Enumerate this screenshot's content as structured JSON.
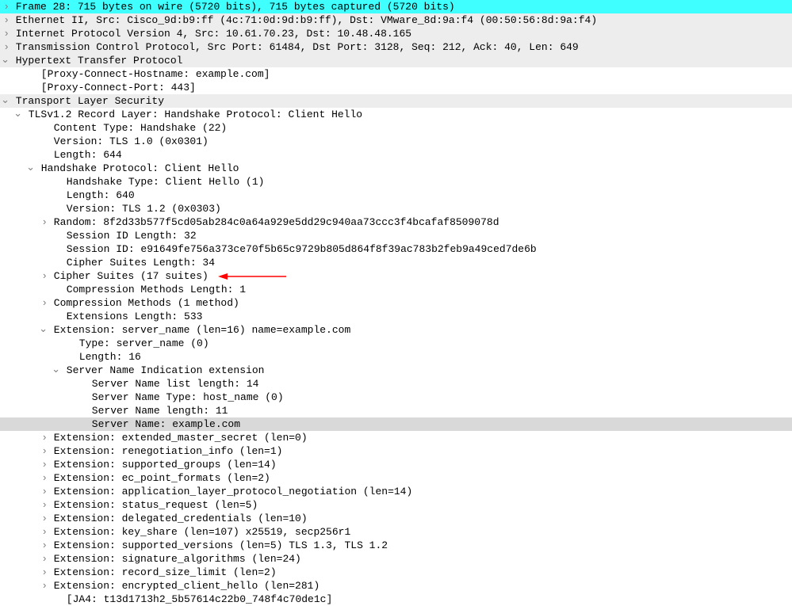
{
  "lines": [
    {
      "indent": 0,
      "g": "arrow",
      "hl": "cyan",
      "k": "l0",
      "t": "Frame 28: 715 bytes on wire (5720 bits), 715 bytes captured (5720 bits)"
    },
    {
      "indent": 0,
      "g": "arrow",
      "hl": "grey",
      "k": "l1",
      "t": "Ethernet II, Src: Cisco_9d:b9:ff (4c:71:0d:9d:b9:ff), Dst: VMware_8d:9a:f4 (00:50:56:8d:9a:f4)"
    },
    {
      "indent": 0,
      "g": "arrow",
      "hl": "grey",
      "k": "l2",
      "t": "Internet Protocol Version 4, Src: 10.61.70.23, Dst: 10.48.48.165"
    },
    {
      "indent": 0,
      "g": "arrow",
      "hl": "grey",
      "k": "l3",
      "t": "Transmission Control Protocol, Src Port: 61484, Dst Port: 3128, Seq: 212, Ack: 40, Len: 649"
    },
    {
      "indent": 0,
      "g": "open",
      "hl": "grey",
      "k": "l4",
      "t": "Hypertext Transfer Protocol"
    },
    {
      "indent": 2,
      "g": "",
      "hl": "",
      "k": "l5",
      "t": "[Proxy-Connect-Hostname: example.com]"
    },
    {
      "indent": 2,
      "g": "",
      "hl": "",
      "k": "l6",
      "t": "[Proxy-Connect-Port: 443]"
    },
    {
      "indent": 0,
      "g": "open",
      "hl": "grey",
      "k": "l7",
      "t": "Transport Layer Security"
    },
    {
      "indent": 1,
      "g": "open",
      "hl": "",
      "k": "l8",
      "t": "TLSv1.2 Record Layer: Handshake Protocol: Client Hello"
    },
    {
      "indent": 3,
      "g": "",
      "hl": "",
      "k": "l9",
      "t": "Content Type: Handshake (22)"
    },
    {
      "indent": 3,
      "g": "",
      "hl": "",
      "k": "l10",
      "t": "Version: TLS 1.0 (0x0301)"
    },
    {
      "indent": 3,
      "g": "",
      "hl": "",
      "k": "l11",
      "t": "Length: 644"
    },
    {
      "indent": 2,
      "g": "open",
      "hl": "",
      "k": "l12",
      "t": "Handshake Protocol: Client Hello"
    },
    {
      "indent": 4,
      "g": "",
      "hl": "",
      "k": "l13",
      "t": "Handshake Type: Client Hello (1)"
    },
    {
      "indent": 4,
      "g": "",
      "hl": "",
      "k": "l14",
      "t": "Length: 640"
    },
    {
      "indent": 4,
      "g": "",
      "hl": "",
      "k": "l15",
      "t": "Version: TLS 1.2 (0x0303)"
    },
    {
      "indent": 3,
      "g": "arrow",
      "hl": "",
      "k": "l16",
      "t": "Random: 8f2d33b577f5cd05ab284c0a64a929e5dd29c940aa73ccc3f4bcafaf8509078d"
    },
    {
      "indent": 4,
      "g": "",
      "hl": "",
      "k": "l17",
      "t": "Session ID Length: 32"
    },
    {
      "indent": 4,
      "g": "",
      "hl": "",
      "k": "l18",
      "t": "Session ID: e91649fe756a373ce70f5b65c9729b805d864f8f39ac783b2feb9a49ced7de6b"
    },
    {
      "indent": 4,
      "g": "",
      "hl": "",
      "k": "l19",
      "t": "Cipher Suites Length: 34"
    },
    {
      "indent": 3,
      "g": "arrow",
      "hl": "",
      "k": "l20",
      "t": "Cipher Suites (17 suites)",
      "annot": true
    },
    {
      "indent": 4,
      "g": "",
      "hl": "",
      "k": "l21",
      "t": "Compression Methods Length: 1"
    },
    {
      "indent": 3,
      "g": "arrow",
      "hl": "",
      "k": "l22",
      "t": "Compression Methods (1 method)"
    },
    {
      "indent": 4,
      "g": "",
      "hl": "",
      "k": "l23",
      "t": "Extensions Length: 533"
    },
    {
      "indent": 3,
      "g": "open",
      "hl": "",
      "k": "l24",
      "t": "Extension: server_name (len=16) name=example.com"
    },
    {
      "indent": 5,
      "g": "",
      "hl": "",
      "k": "l25",
      "t": "Type: server_name (0)"
    },
    {
      "indent": 5,
      "g": "",
      "hl": "",
      "k": "l26",
      "t": "Length: 16"
    },
    {
      "indent": 4,
      "g": "open",
      "hl": "",
      "k": "l27",
      "t": "Server Name Indication extension"
    },
    {
      "indent": 6,
      "g": "",
      "hl": "",
      "k": "l28",
      "t": "Server Name list length: 14"
    },
    {
      "indent": 6,
      "g": "",
      "hl": "",
      "k": "l29",
      "t": "Server Name Type: host_name (0)"
    },
    {
      "indent": 6,
      "g": "",
      "hl": "",
      "k": "l30",
      "t": "Server Name length: 11"
    },
    {
      "indent": 6,
      "g": "",
      "hl": "sel",
      "k": "l31",
      "t": "Server Name: example.com"
    },
    {
      "indent": 3,
      "g": "arrow",
      "hl": "",
      "k": "l32",
      "t": "Extension: extended_master_secret (len=0)"
    },
    {
      "indent": 3,
      "g": "arrow",
      "hl": "",
      "k": "l33",
      "t": "Extension: renegotiation_info (len=1)"
    },
    {
      "indent": 3,
      "g": "arrow",
      "hl": "",
      "k": "l34",
      "t": "Extension: supported_groups (len=14)"
    },
    {
      "indent": 3,
      "g": "arrow",
      "hl": "",
      "k": "l35",
      "t": "Extension: ec_point_formats (len=2)"
    },
    {
      "indent": 3,
      "g": "arrow",
      "hl": "",
      "k": "l36",
      "t": "Extension: application_layer_protocol_negotiation (len=14)"
    },
    {
      "indent": 3,
      "g": "arrow",
      "hl": "",
      "k": "l37",
      "t": "Extension: status_request (len=5)"
    },
    {
      "indent": 3,
      "g": "arrow",
      "hl": "",
      "k": "l38",
      "t": "Extension: delegated_credentials (len=10)"
    },
    {
      "indent": 3,
      "g": "arrow",
      "hl": "",
      "k": "l39",
      "t": "Extension: key_share (len=107) x25519, secp256r1"
    },
    {
      "indent": 3,
      "g": "arrow",
      "hl": "",
      "k": "l40",
      "t": "Extension: supported_versions (len=5) TLS 1.3, TLS 1.2"
    },
    {
      "indent": 3,
      "g": "arrow",
      "hl": "",
      "k": "l41",
      "t": "Extension: signature_algorithms (len=24)"
    },
    {
      "indent": 3,
      "g": "arrow",
      "hl": "",
      "k": "l42",
      "t": "Extension: record_size_limit (len=2)"
    },
    {
      "indent": 3,
      "g": "arrow",
      "hl": "",
      "k": "l43",
      "t": "Extension: encrypted_client_hello (len=281)"
    },
    {
      "indent": 4,
      "g": "",
      "hl": "",
      "k": "l44",
      "t": "[JA4: t13d1713h2_5b57614c22b0_748f4c70de1c]"
    }
  ]
}
